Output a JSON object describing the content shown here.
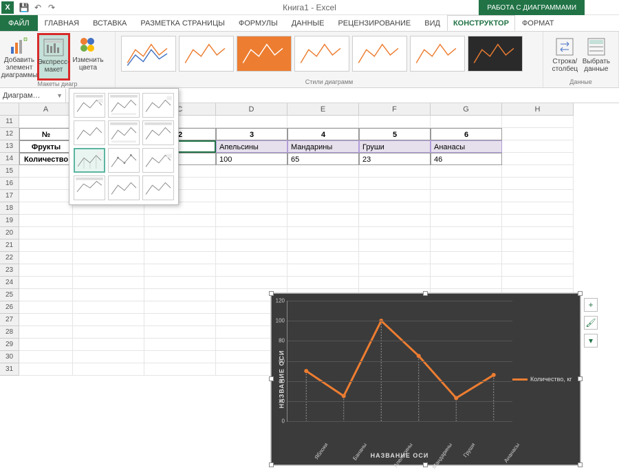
{
  "app": {
    "title": "Книга1 - Excel",
    "tool_context": "РАБОТА С ДИАГРАММАМИ"
  },
  "qat": {
    "save": "💾",
    "undo": "↶",
    "redo": "↷"
  },
  "tabs": {
    "file": "ФАЙЛ",
    "items": [
      "ГЛАВНАЯ",
      "ВСТАВКА",
      "РАЗМЕТКА СТРАНИЦЫ",
      "ФОРМУЛЫ",
      "ДАННЫЕ",
      "РЕЦЕНЗИРОВАНИЕ",
      "ВИД",
      "КОНСТРУКТОР",
      "ФОРМАТ"
    ]
  },
  "ribbon": {
    "add_element": "Добавить элемент диаграммы",
    "quick_layout": "Экспресс-макет",
    "change_colors": "Изменить цвета",
    "group_layouts": "Макеты диагр",
    "group_styles": "Стили диаграмм",
    "switch_rowcol": "Строка/столбец",
    "select_data": "Выбрать данные",
    "group_data": "Данные"
  },
  "namebox": "Диаграм…",
  "columns": [
    "A",
    "B",
    "C",
    "D",
    "E",
    "F",
    "G",
    "H"
  ],
  "rows_start": 11,
  "rows_count": 21,
  "table": {
    "r12": {
      "A": "№",
      "B": "",
      "C": "2",
      "D": "3",
      "E": "4",
      "F": "5",
      "G": "6"
    },
    "r13": {
      "A": "Фрукты",
      "B": "",
      "C": "ы",
      "D": "Апельсины",
      "E": "Мандарины",
      "F": "Груши",
      "G": "Ананасы"
    },
    "r14": {
      "A": "Количество",
      "B": "",
      "C": "25",
      "D": "100",
      "E": "65",
      "F": "23",
      "G": "46"
    }
  },
  "chart_data": {
    "type": "line",
    "categories": [
      "Яблоки",
      "Бананы",
      "Апельсины",
      "Мандарины",
      "Груши",
      "Ананасы"
    ],
    "series": [
      {
        "name": "Количество, кг",
        "values": [
          50,
          25,
          100,
          65,
          23,
          46
        ]
      }
    ],
    "ylabel": "НАЗВАНИЕ ОСИ",
    "xlabel": "НАЗВАНИЕ ОСИ",
    "ylim": [
      0,
      120
    ],
    "ystep": 20
  },
  "side_buttons": {
    "plus": "+",
    "brush": "🖌",
    "filter": "▾"
  }
}
